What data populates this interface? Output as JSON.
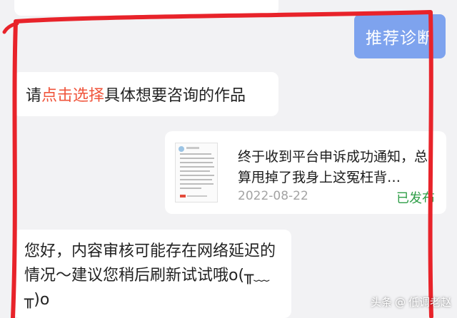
{
  "header": {
    "recommend_button": "推荐诊断"
  },
  "prompt": {
    "prefix": "请",
    "highlight": "点击选择",
    "suffix": "具体想要咨询的作品"
  },
  "work_card": {
    "title": "终于收到平台申诉成功通知，总算甩掉了我身上这冤枉背…",
    "date": "2022-08-22",
    "status": "已发布"
  },
  "reply": {
    "text": "您好，内容审核可能存在网络延迟的情况～建议您稍后刷新试试哦o(╥﹏╥)o"
  },
  "watermark": {
    "platform": "头条",
    "account": "低调老赵"
  },
  "colors": {
    "accent_button": "#7ea3ee",
    "highlight": "#f0553c",
    "status_published": "#2f9e48",
    "annotation": "#e8232a"
  },
  "icons": {
    "watermark": "at-icon"
  }
}
